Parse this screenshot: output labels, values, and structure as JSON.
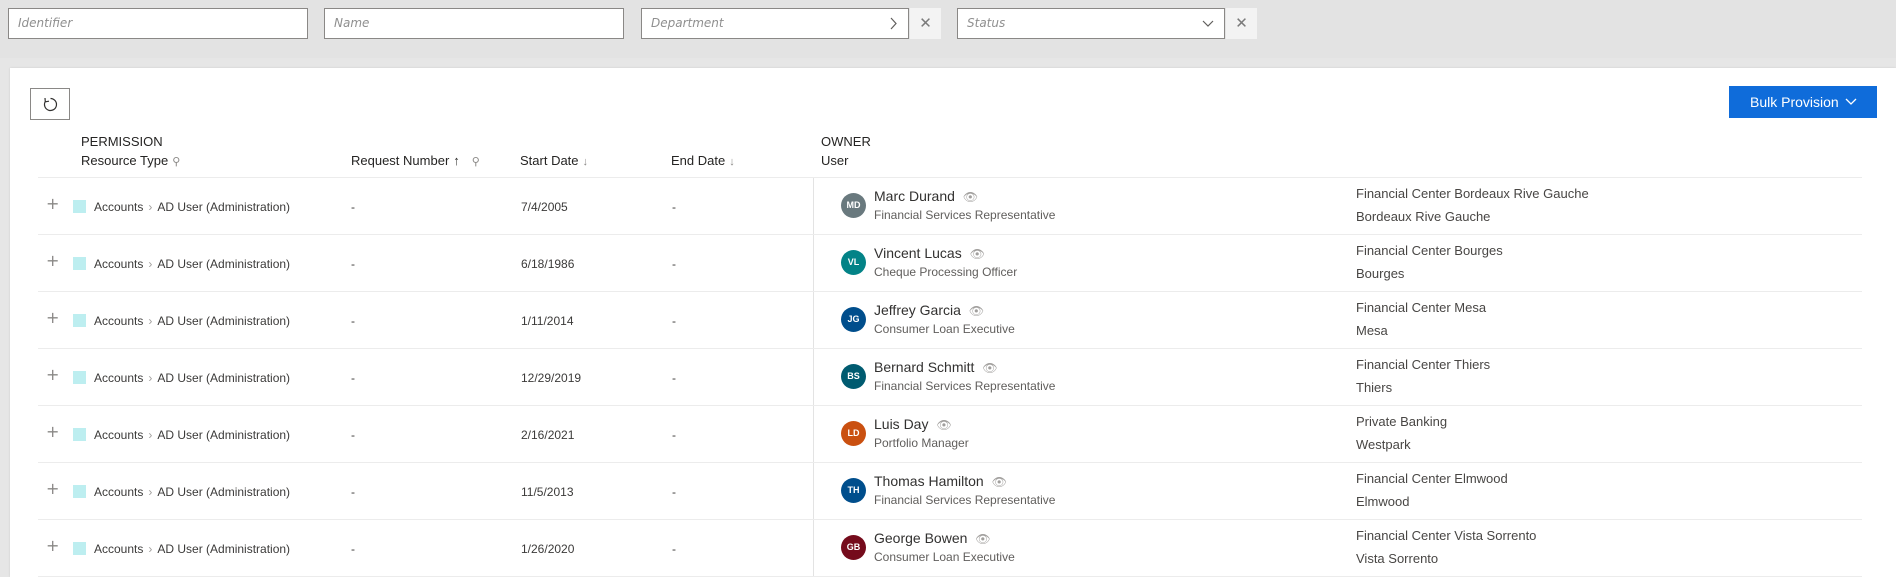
{
  "filters": {
    "identifier_placeholder": "Identifier",
    "name_placeholder": "Name",
    "department_placeholder": "Department",
    "status_placeholder": "Status"
  },
  "toolbar": {
    "bulk_label": "Bulk Provision",
    "accent": "#0f6cda"
  },
  "table": {
    "group_permission": "PERMISSION",
    "group_owner": "OWNER",
    "col_resource_type": "Resource Type",
    "col_request_number": "Request Number",
    "col_start_date": "Start Date",
    "col_end_date": "End Date",
    "col_user": "User",
    "rows": [
      {
        "category": "Accounts",
        "resource": "AD User (Administration)",
        "request": "-",
        "start": "7/4/2005",
        "end": "-",
        "initials": "MD",
        "avatar_color": "#69797e",
        "name": "Marc Durand",
        "title": "Financial Services Representative",
        "loc1": "Financial Center Bordeaux Rive Gauche",
        "loc2": "Bordeaux Rive Gauche"
      },
      {
        "category": "Accounts",
        "resource": "AD User (Administration)",
        "request": "-",
        "start": "6/18/1986",
        "end": "-",
        "initials": "VL",
        "avatar_color": "#038387",
        "name": "Vincent Lucas",
        "title": "Cheque Processing Officer",
        "loc1": "Financial Center Bourges",
        "loc2": "Bourges"
      },
      {
        "category": "Accounts",
        "resource": "AD User (Administration)",
        "request": "-",
        "start": "1/11/2014",
        "end": "-",
        "initials": "JG",
        "avatar_color": "#004e8c",
        "name": "Jeffrey Garcia",
        "title": "Consumer Loan Executive",
        "loc1": "Financial Center Mesa",
        "loc2": "Mesa"
      },
      {
        "category": "Accounts",
        "resource": "AD User (Administration)",
        "request": "-",
        "start": "12/29/2019",
        "end": "-",
        "initials": "BS",
        "avatar_color": "#005b70",
        "name": "Bernard Schmitt",
        "title": "Financial Services Representative",
        "loc1": "Financial Center Thiers",
        "loc2": "Thiers"
      },
      {
        "category": "Accounts",
        "resource": "AD User (Administration)",
        "request": "-",
        "start": "2/16/2021",
        "end": "-",
        "initials": "LD",
        "avatar_color": "#ca5010",
        "name": "Luis Day",
        "title": "Portfolio Manager",
        "loc1": "Private Banking",
        "loc2": "Westpark"
      },
      {
        "category": "Accounts",
        "resource": "AD User (Administration)",
        "request": "-",
        "start": "11/5/2013",
        "end": "-",
        "initials": "TH",
        "avatar_color": "#004e8c",
        "name": "Thomas Hamilton",
        "title": "Financial Services Representative",
        "loc1": "Financial Center Elmwood",
        "loc2": "Elmwood"
      },
      {
        "category": "Accounts",
        "resource": "AD User (Administration)",
        "request": "-",
        "start": "1/26/2020",
        "end": "-",
        "initials": "GB",
        "avatar_color": "#750b1c",
        "name": "George Bowen",
        "title": "Consumer Loan Executive",
        "loc1": "Financial Center Vista Sorrento",
        "loc2": "Vista Sorrento"
      }
    ]
  }
}
